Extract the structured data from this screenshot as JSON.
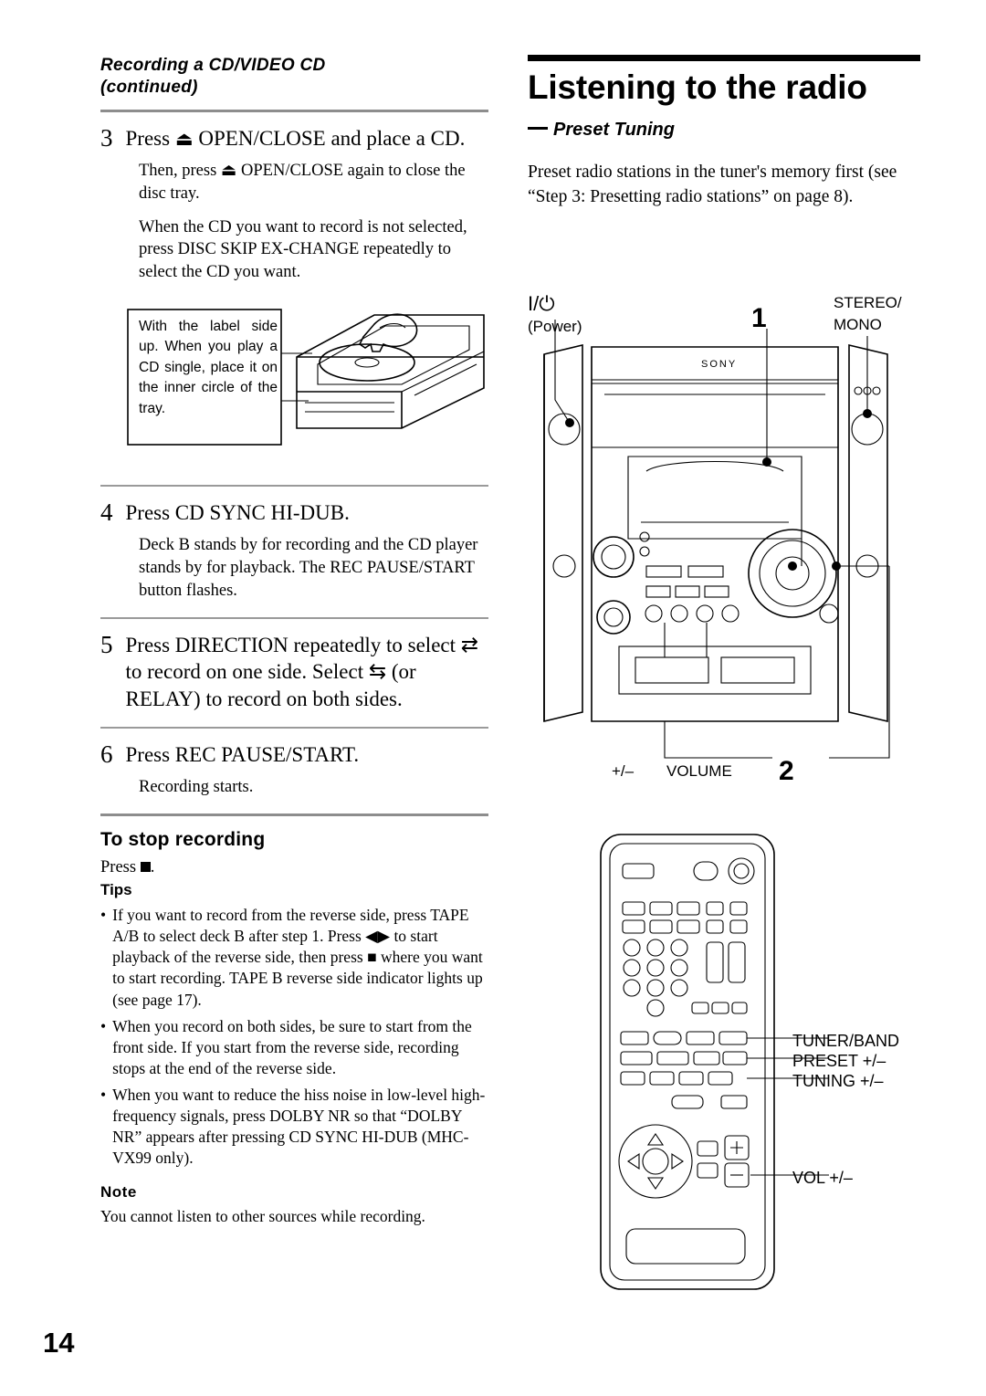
{
  "left": {
    "section_title_line1": "Recording a CD/VIDEO CD",
    "section_title_line2": "(continued)",
    "steps": [
      {
        "num": "3",
        "title_pre": "Press ",
        "title_icon": "⏏",
        "title_post": " OPEN/CLOSE and place a CD.",
        "body1": "Then, press ⏏ OPEN/CLOSE again to close the disc tray.",
        "body2": "When the CD you want to record is not selected, press DISC SKIP EX-CHANGE repeatedly to select the CD you want."
      },
      {
        "num": "4",
        "title": "Press CD SYNC HI-DUB.",
        "body1": "Deck B stands by for recording and the CD player stands by for playback. The REC PAUSE/START button flashes."
      },
      {
        "num": "5",
        "title": "Press DIRECTION repeatedly to select ⇄ to record on one side. Select ⇆ (or RELAY) to record on both sides."
      },
      {
        "num": "6",
        "title": "Press REC PAUSE/START.",
        "body1": "Recording starts."
      }
    ],
    "figure_caption": "With the label side up. When you play a CD single, place it on the inner circle of the tray.",
    "stop_heading": "To stop recording",
    "stop_text_pre": "Press ",
    "stop_text_post": ".",
    "tips_heading": "Tips",
    "tips": [
      "If you want to record from the reverse side, press TAPE A/B to select deck B after step 1. Press ◀▶ to start playback of the reverse side, then press ■ where you want to start recording. TAPE B reverse side indicator lights up (see page 17).",
      "When you record on both sides, be sure to start from the front side. If you start from the reverse side, recording stops at the end of the reverse side.",
      "When you want to reduce the hiss noise in low-level high-frequency signals, press DOLBY NR so that “DOLBY NR” appears after pressing CD SYNC HI-DUB (MHC-VX99 only)."
    ],
    "note_heading": "Note",
    "note_text": "You cannot listen to other sources while recording."
  },
  "right": {
    "title": "Listening to the radio",
    "subtitle": "Preset Tuning",
    "intro": "Preset radio stations in the tuner's memory first (see “Step 3: Presetting radio stations” on page 8).",
    "labels": {
      "power_symbol": "I/⏻",
      "power_text": "(Power)",
      "stereo_mono_1": "STEREO/",
      "stereo_mono_2": "MONO",
      "callout_1": "1",
      "callout_2": "2",
      "volume_pm": "+/–",
      "volume": "VOLUME",
      "tuner_band": "TUNER/BAND",
      "preset": "PRESET +/–",
      "tuning": "TUNING +/–",
      "vol": "VOL +/–",
      "brand": "SONY"
    }
  },
  "page_number": "14"
}
